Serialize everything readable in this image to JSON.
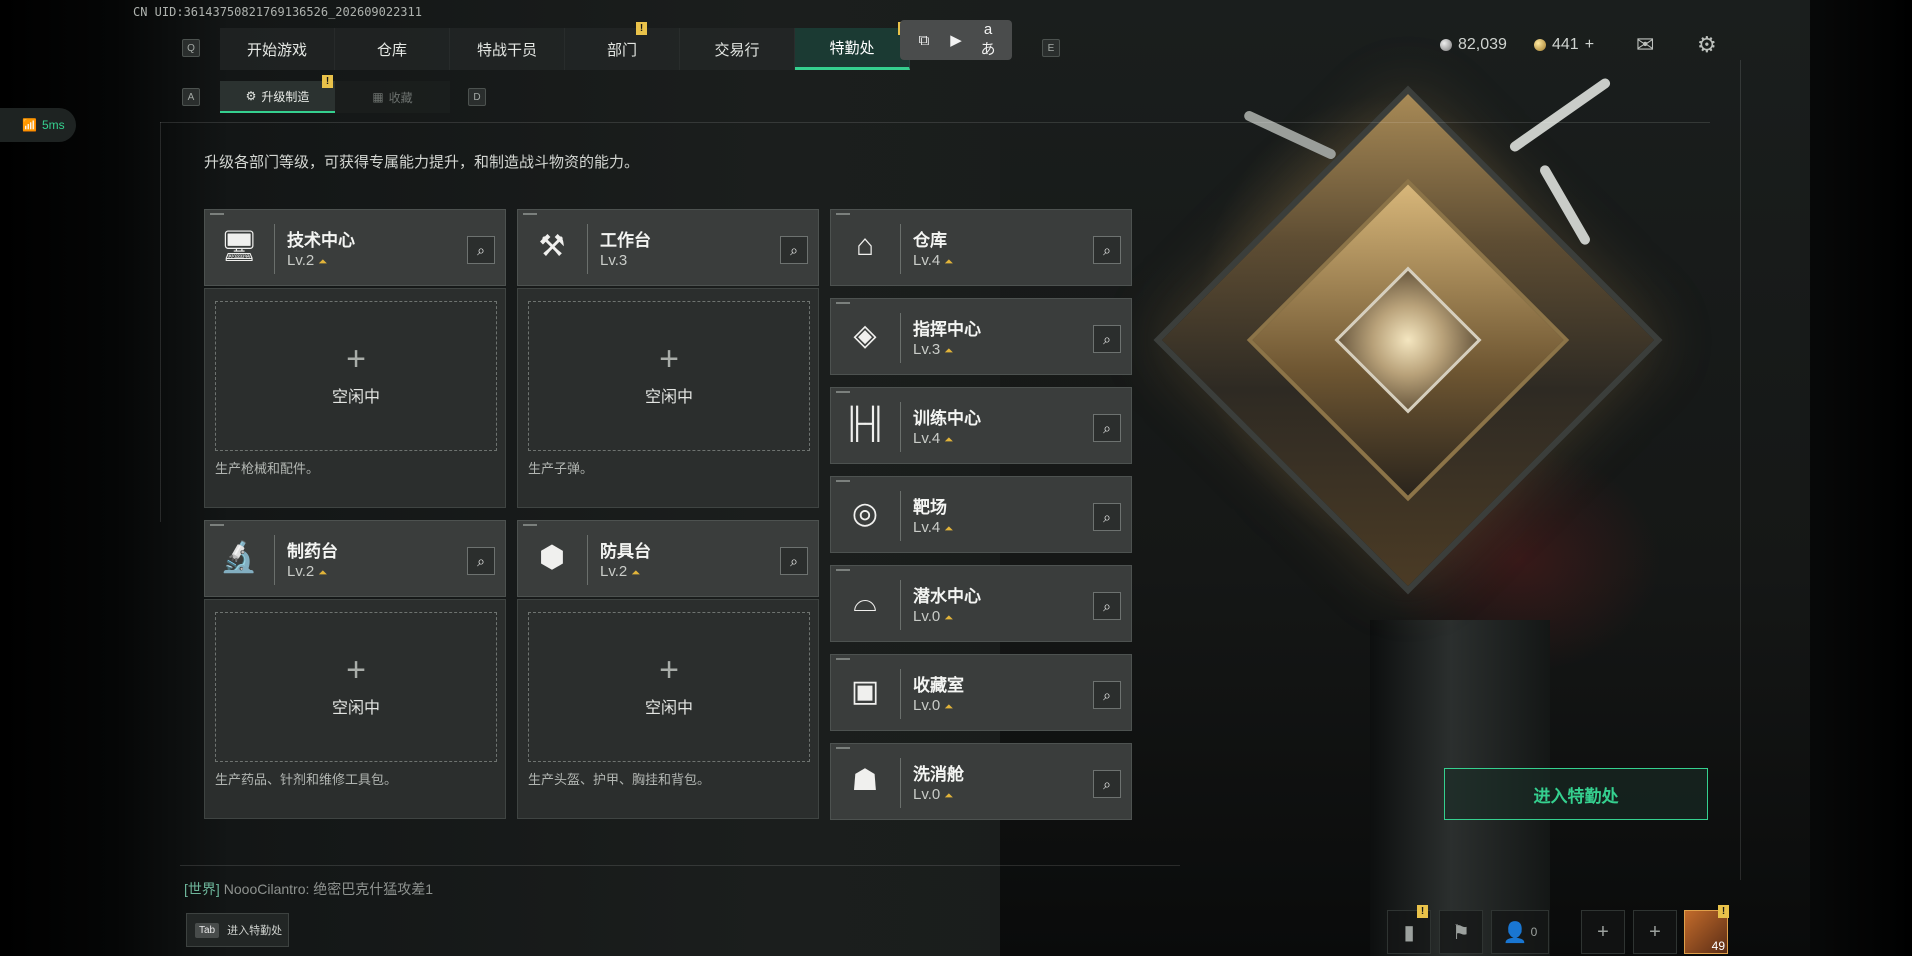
{
  "uid": "CN UID:3614375082176913652​6_202609022311",
  "nav": {
    "left_key": "Q",
    "right_key": "E",
    "tabs": [
      {
        "label": "开始游戏",
        "active": false
      },
      {
        "label": "仓库",
        "active": false
      },
      {
        "label": "特战干员",
        "active": false
      },
      {
        "label": "部门",
        "active": false,
        "alert": "!"
      },
      {
        "label": "交易行",
        "active": false
      },
      {
        "label": "特勤处",
        "active": true,
        "alert": "!"
      }
    ]
  },
  "float_toolbar": {
    "icons": [
      "screenshot-icon",
      "record-icon",
      "translate-icon"
    ]
  },
  "subtabs": {
    "left_key": "A",
    "right_key": "D",
    "items": [
      {
        "label": "升级制造",
        "icon": "gear-icon",
        "active": true,
        "alert": "!"
      },
      {
        "label": "收藏",
        "icon": "collection-icon",
        "active": false
      }
    ]
  },
  "ping": "5ms",
  "currency": {
    "silver": "82,039",
    "gold": "441",
    "gold_add": "+"
  },
  "description": "升级各部门等级，可获得专属能力提升，和制造战斗物资的能力。",
  "workshops": [
    {
      "name": "技术中心",
      "level": "Lv.2",
      "icon": "computer-icon",
      "slot": "空闲中",
      "slot_plus": "+",
      "hint": "生产枪械和配件。"
    },
    {
      "name": "工作台",
      "level": "Lv.3",
      "icon": "tools-icon",
      "slot": "空闲中",
      "slot_plus": "+",
      "hint": "生产子弹。"
    },
    {
      "name": "制药台",
      "level": "Lv.2",
      "icon": "microscope-icon",
      "slot": "空闲中",
      "slot_plus": "+",
      "hint": "生产药品、针剂和维修工具包。"
    },
    {
      "name": "防具台",
      "level": "Lv.2",
      "icon": "armor-icon",
      "slot": "空闲中",
      "slot_plus": "+",
      "hint": "生产头盔、护甲、胸挂和背包。"
    }
  ],
  "facilities": [
    {
      "name": "仓库",
      "level": "Lv.4",
      "icon": "warehouse-icon"
    },
    {
      "name": "指挥中心",
      "level": "Lv.3",
      "icon": "command-icon"
    },
    {
      "name": "训练中心",
      "level": "Lv.4",
      "icon": "dumbbell-icon"
    },
    {
      "name": "靶场",
      "level": "Lv.4",
      "icon": "target-icon"
    },
    {
      "name": "潜水中心",
      "level": "Lv.0",
      "icon": "diving-icon"
    },
    {
      "name": "收藏室",
      "level": "Lv.0",
      "icon": "collection-room-icon"
    },
    {
      "name": "洗消舱",
      "level": "Lv.0",
      "icon": "decontamination-icon"
    }
  ],
  "enter_button": "进入特勤处",
  "chat": {
    "channel": "[世界]",
    "message": "NoooCilantro: 绝密巴克什猛攻差1"
  },
  "tab_hint": {
    "key": "Tab",
    "label": "进入特勤处"
  },
  "bottom_bar": {
    "friends_count": "0",
    "player_level": "49"
  },
  "colors": {
    "accent": "#35d08f",
    "alert": "#e9c24a",
    "upgrade": "#e2b43a"
  }
}
